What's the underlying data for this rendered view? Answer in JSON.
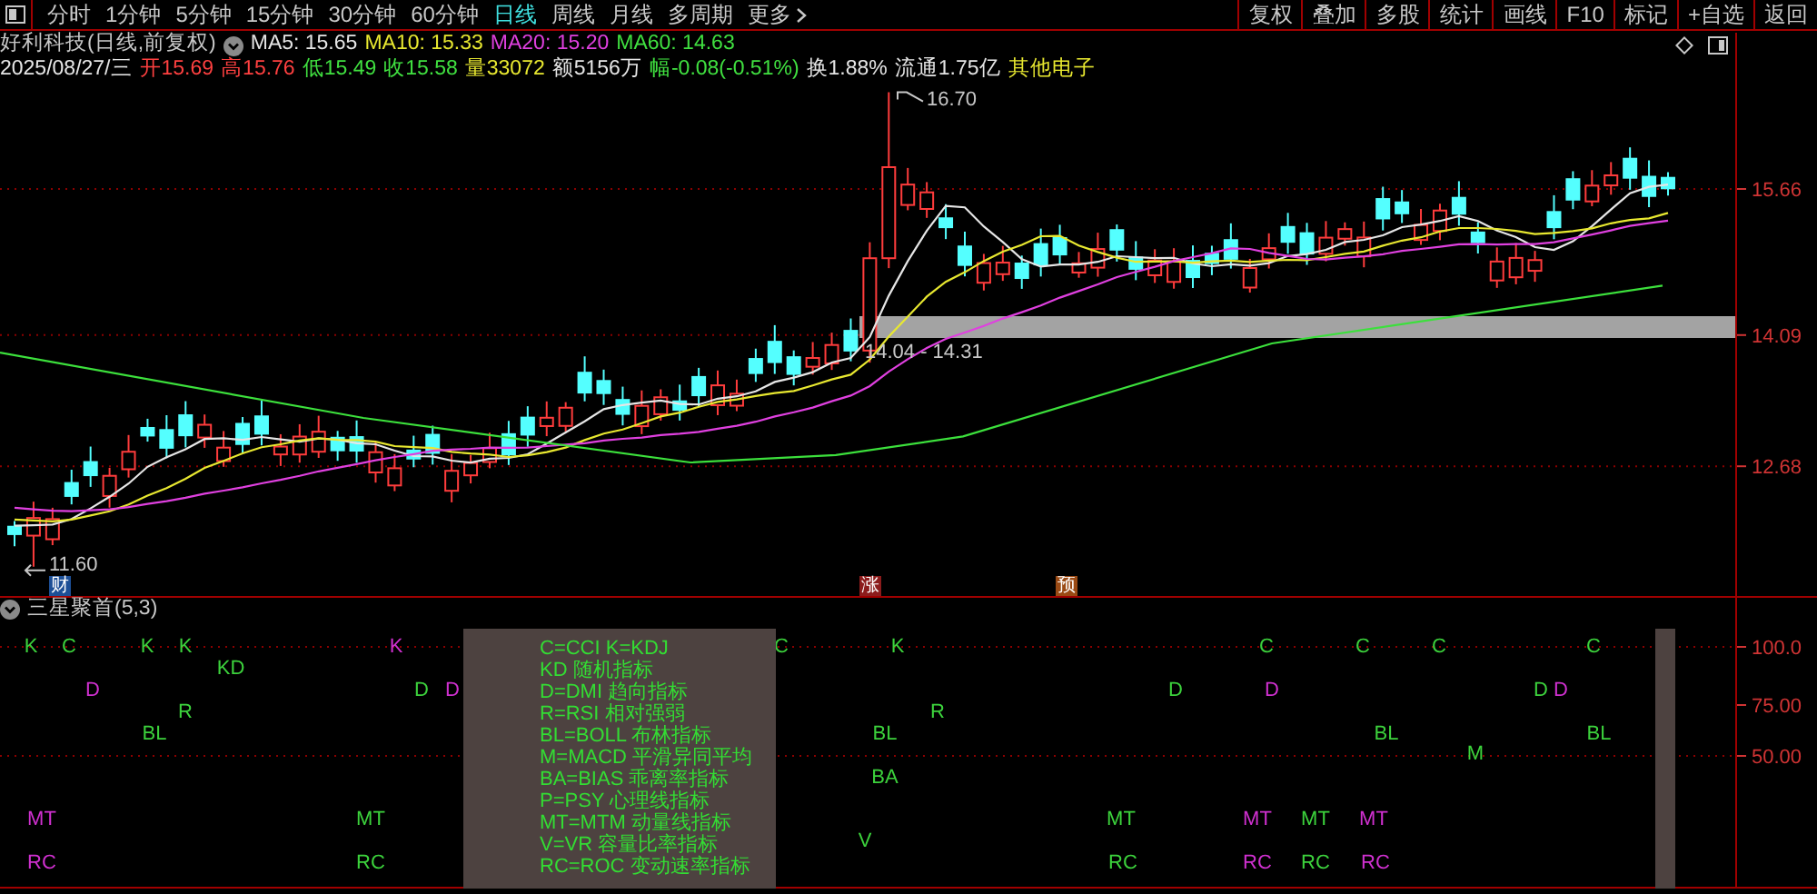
{
  "toolbar": {
    "period_tabs": [
      {
        "label": "分时",
        "selected": false
      },
      {
        "label": "1分钟",
        "selected": false
      },
      {
        "label": "5分钟",
        "selected": false
      },
      {
        "label": "15分钟",
        "selected": false
      },
      {
        "label": "30分钟",
        "selected": false
      },
      {
        "label": "60分钟",
        "selected": false
      },
      {
        "label": "日线",
        "selected": true
      },
      {
        "label": "周线",
        "selected": false
      },
      {
        "label": "月线",
        "selected": false
      },
      {
        "label": "多周期",
        "selected": false
      },
      {
        "label": "更多",
        "selected": false,
        "kind": "menu"
      }
    ],
    "buttons": [
      "复权",
      "叠加",
      "多股",
      "统计",
      "画线",
      "F10",
      "标记",
      "+自选",
      "返回"
    ]
  },
  "stock_header": {
    "name": "好利科技(日线,前复权)",
    "ma": [
      {
        "text": "MA5: 15.65",
        "color": "#e6e6e6"
      },
      {
        "text": "MA10: 15.33",
        "color": "#e8e830"
      },
      {
        "text": "MA20: 15.20",
        "color": "#e040e0"
      },
      {
        "text": "MA60: 14.63",
        "color": "#40e040"
      }
    ]
  },
  "quote": [
    {
      "text": "2025/08/27/三",
      "color": "#e6e6e6"
    },
    {
      "text": "开15.69",
      "color": "#ff4040"
    },
    {
      "text": "高15.76",
      "color": "#ff4040"
    },
    {
      "text": "低15.49",
      "color": "#40e040"
    },
    {
      "text": "收15.58",
      "color": "#40e040"
    },
    {
      "text": "量33072",
      "color": "#e8e830"
    },
    {
      "text": "额5156万",
      "color": "#e6e6e6"
    },
    {
      "text": "幅-0.08(-0.51%)",
      "color": "#40e040"
    },
    {
      "text": "换1.88%",
      "color": "#e6e6e6"
    },
    {
      "text": "流通1.75亿",
      "color": "#e6e6e6"
    },
    {
      "text": "其他电子",
      "color": "#e8e830"
    }
  ],
  "price_axis": {
    "ticks": [
      "15.66",
      "14.09",
      "12.68"
    ]
  },
  "annotations": {
    "high": "16.70",
    "low": "11.60",
    "zone": "14.04 - 14.31"
  },
  "event_markers": [
    {
      "text": "财",
      "color": "#1d4f96"
    },
    {
      "text": "涨",
      "color": "#8c1c1c"
    },
    {
      "text": "预",
      "color": "#9a4a14"
    }
  ],
  "indicator": {
    "title": "三星聚首(5,3)",
    "axis": [
      "100.0",
      "75.00",
      "50.00"
    ],
    "signal_rows": [
      {
        "signals": [
          {
            "text": "K",
            "color": "#3cd23c"
          },
          {
            "text": "C",
            "color": "#3cd23c"
          },
          {
            "text": "K",
            "color": "#3cd23c"
          },
          {
            "text": "K",
            "color": "#3cd23c"
          },
          {
            "text": "K",
            "color": "#d030d0"
          },
          {
            "text": "C",
            "color": "#3cd23c"
          },
          {
            "text": "K",
            "color": "#3cd23c"
          },
          {
            "text": "C",
            "color": "#3cd23c"
          },
          {
            "text": "C",
            "color": "#3cd23c"
          },
          {
            "text": "C",
            "color": "#3cd23c"
          },
          {
            "text": "C",
            "color": "#3cd23c"
          }
        ]
      },
      {
        "signals": [
          {
            "text": "KD",
            "color": "#3cd23c"
          }
        ]
      },
      {
        "signals": [
          {
            "text": "D",
            "color": "#d030d0"
          },
          {
            "text": "D",
            "color": "#3cd23c"
          },
          {
            "text": "D",
            "color": "#d030d0"
          },
          {
            "text": "D",
            "color": "#3cd23c"
          },
          {
            "text": "D",
            "color": "#d030d0"
          },
          {
            "text": "D",
            "color": "#3cd23c"
          },
          {
            "text": "D",
            "color": "#d030d0"
          }
        ]
      },
      {
        "signals": [
          {
            "text": "R",
            "color": "#3cd23c"
          },
          {
            "text": "R",
            "color": "#3cd23c"
          }
        ]
      },
      {
        "signals": [
          {
            "text": "BL",
            "color": "#3cd23c"
          },
          {
            "text": "BL",
            "color": "#3cd23c"
          },
          {
            "text": "BL",
            "color": "#3cd23c"
          },
          {
            "text": "BL",
            "color": "#3cd23c"
          }
        ]
      },
      {
        "signals": [
          {
            "text": "M",
            "color": "#3cd23c"
          }
        ]
      },
      {
        "signals": [
          {
            "text": "BA",
            "color": "#3cd23c"
          }
        ]
      },
      {
        "signals": [
          {
            "text": "MT",
            "color": "#d030d0"
          },
          {
            "text": "MT",
            "color": "#3cd23c"
          },
          {
            "text": "MT",
            "color": "#3cd23c"
          },
          {
            "text": "MT",
            "color": "#d030d0"
          },
          {
            "text": "MT",
            "color": "#3cd23c"
          },
          {
            "text": "MT",
            "color": "#d030d0"
          }
        ]
      },
      {
        "signals": [
          {
            "text": "V",
            "color": "#3cd23c"
          }
        ]
      },
      {
        "signals": [
          {
            "text": "RC",
            "color": "#d030d0"
          },
          {
            "text": "RC",
            "color": "#3cd23c"
          },
          {
            "text": "RC",
            "color": "#3cd23c"
          },
          {
            "text": "RC",
            "color": "#d030d0"
          },
          {
            "text": "RC",
            "color": "#3cd23c"
          },
          {
            "text": "RC",
            "color": "#d030d0"
          }
        ]
      }
    ],
    "legend": [
      "C=CCI    K=KDJ",
      "KD 随机指标",
      "D=DMI 趋向指标",
      "R=RSI 相对强弱",
      "BL=BOLL 布林指标",
      "M=MACD 平滑异同平均",
      "BA=BIAS 乖离率指标",
      "P=PSY 心理线指标",
      "MT=MTM 动量线指标",
      "V=VR 容量比率指标",
      "RC=ROC 变动速率指标"
    ]
  }
}
